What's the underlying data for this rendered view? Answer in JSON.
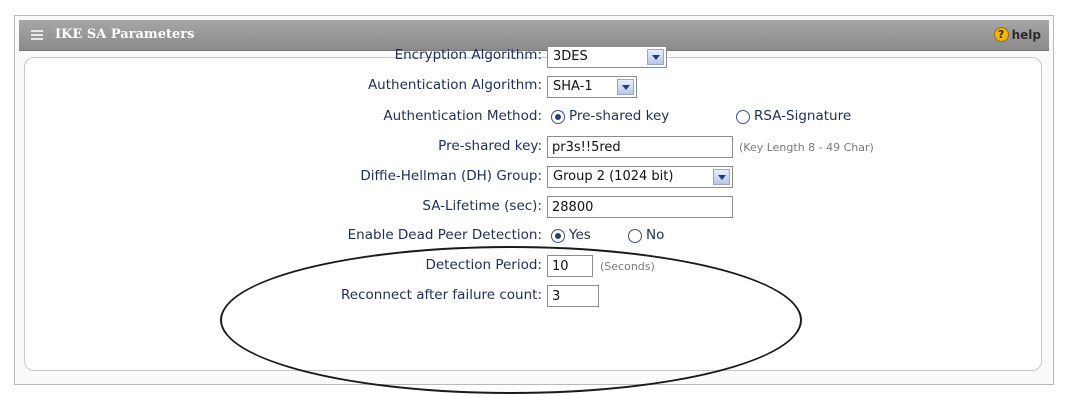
{
  "panel": {
    "title": "IKE SA Parameters",
    "help_label": "help",
    "help_icon": "?"
  },
  "fields": {
    "encryption": {
      "label": "Encryption Algorithm:",
      "value": "3DES"
    },
    "authentication": {
      "label": "Authentication Algorithm:",
      "value": "SHA-1"
    },
    "auth_method": {
      "label": "Authentication Method:",
      "options": [
        "Pre-shared key",
        "RSA-Signature"
      ],
      "selected": "Pre-shared key"
    },
    "preshared_key": {
      "label": "Pre-shared key:",
      "value": "pr3s!!5red",
      "hint": "(Key Length 8 - 49 Char)"
    },
    "dh_group": {
      "label": "Diffie-Hellman (DH) Group:",
      "value": "Group 2 (1024 bit)"
    },
    "sa_lifetime": {
      "label": "SA-Lifetime (sec):",
      "value": "28800"
    },
    "dead_peer": {
      "label": "Enable Dead Peer Detection:",
      "options": [
        "Yes",
        "No"
      ],
      "selected": "Yes"
    },
    "detection_period": {
      "label": "Detection Period:",
      "value": "10",
      "hint": "(Seconds)"
    },
    "reconnect": {
      "label": "Reconnect after failure count:",
      "value": "3"
    }
  }
}
